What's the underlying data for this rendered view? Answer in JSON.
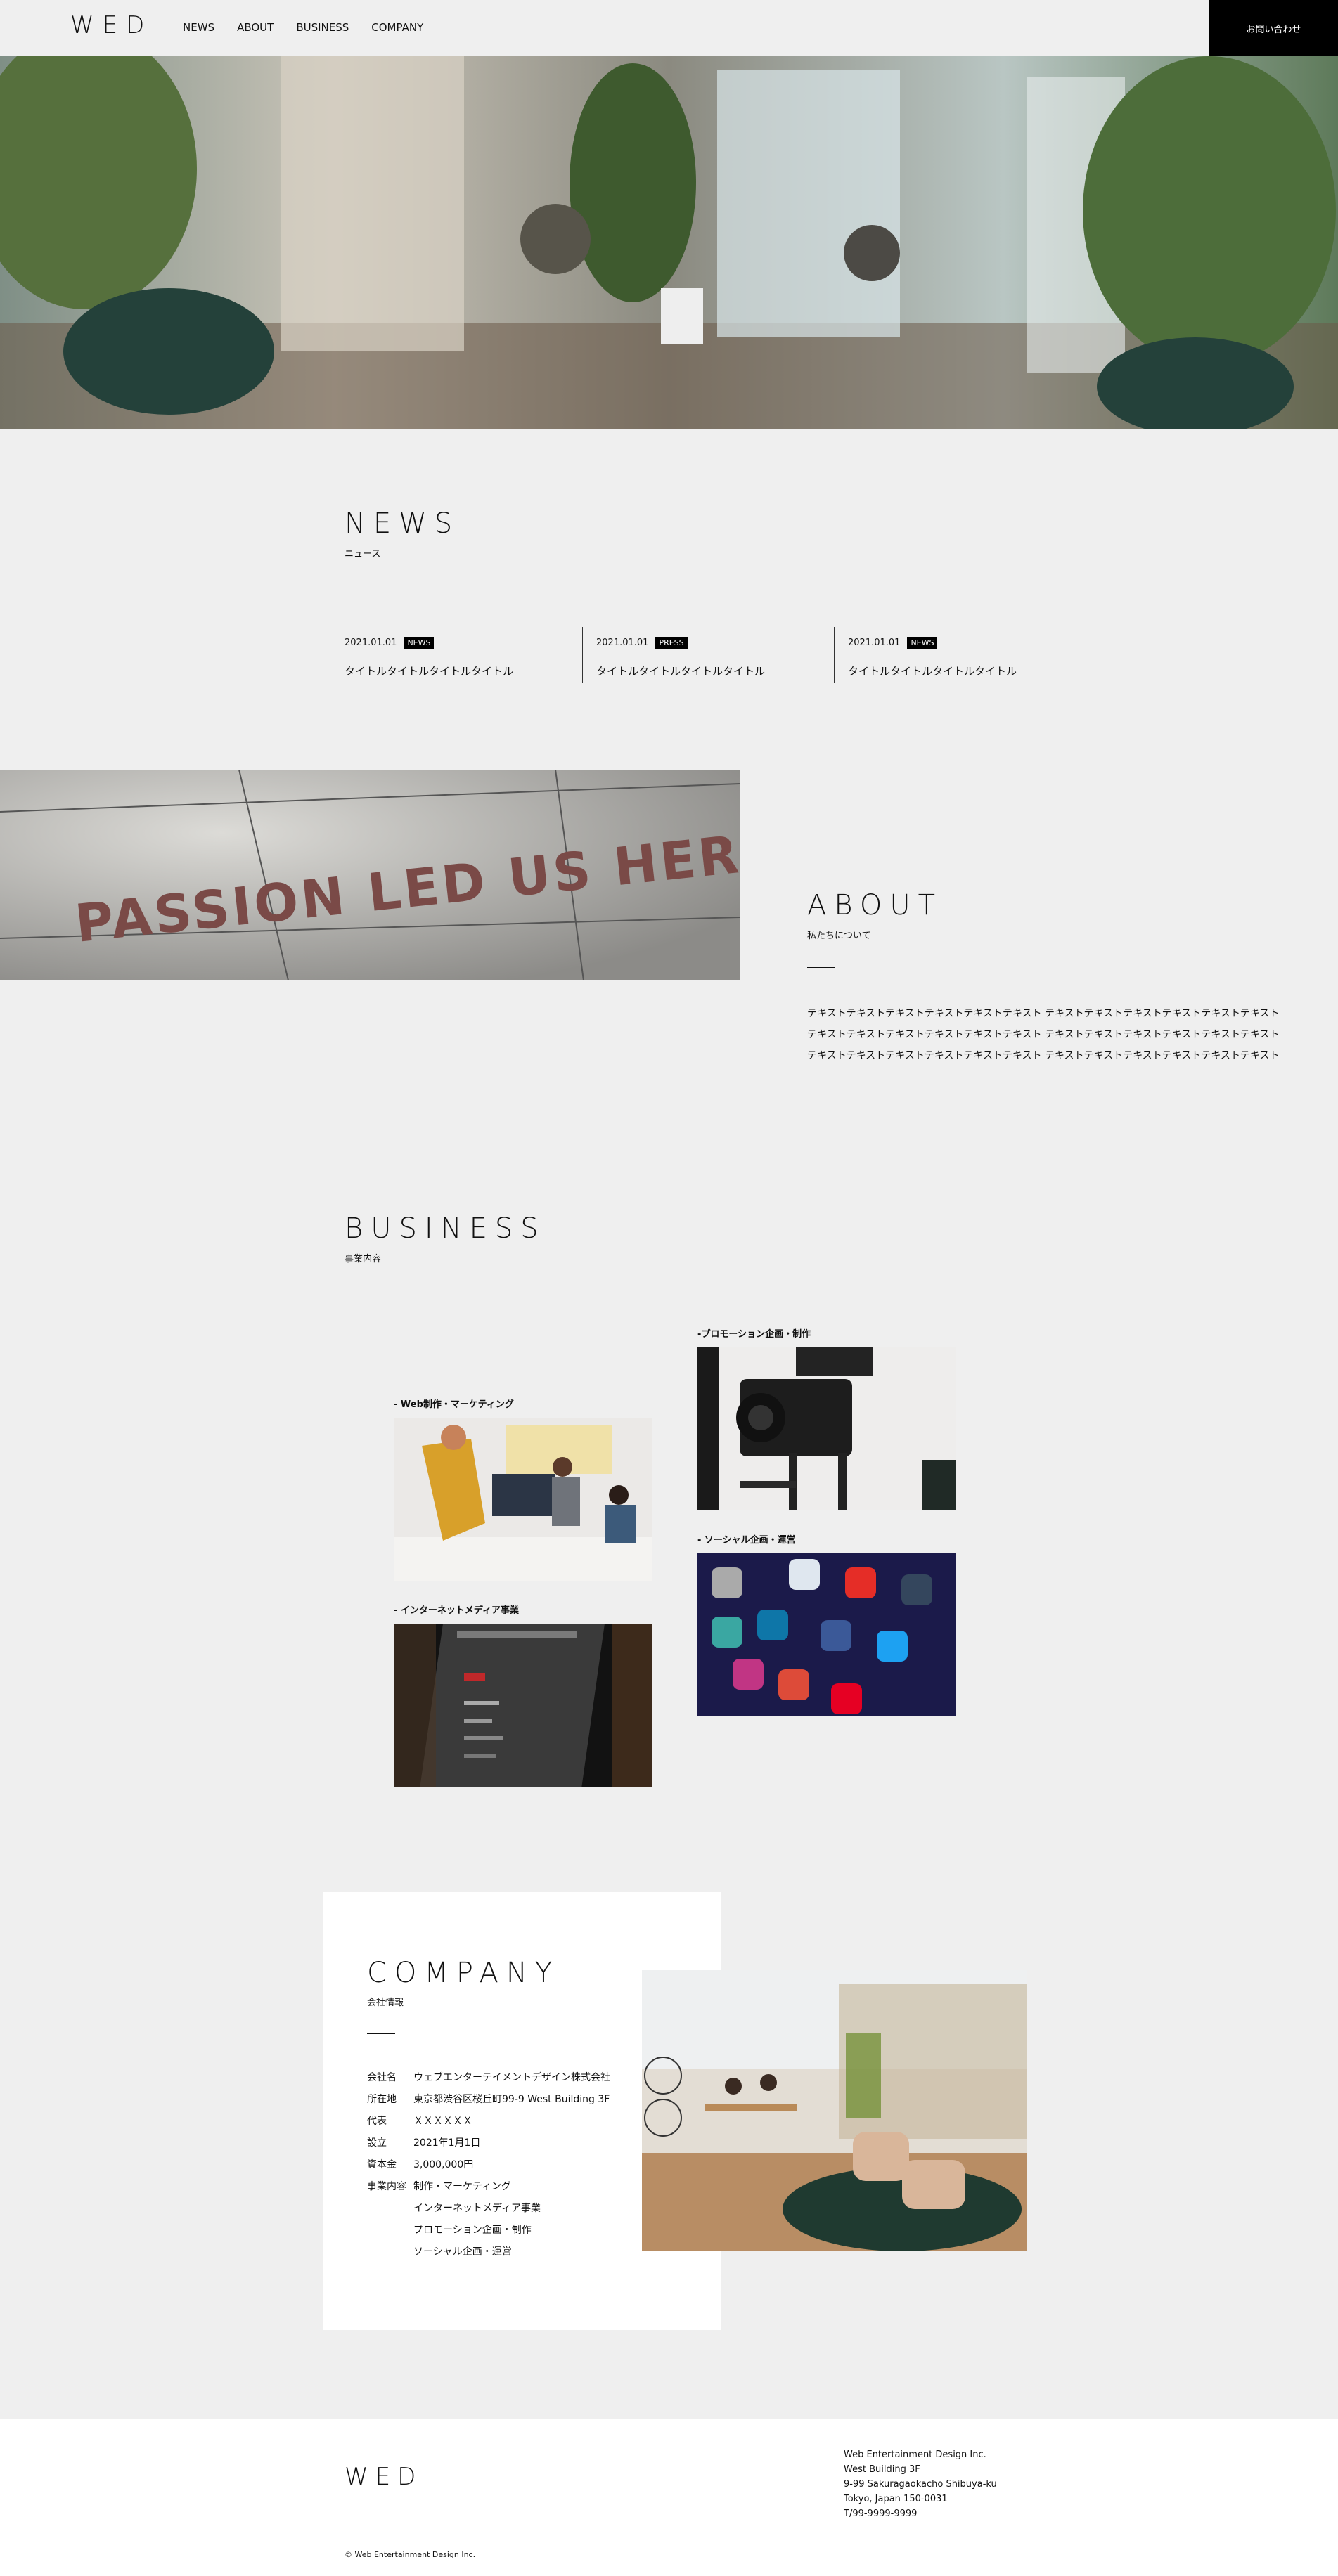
{
  "header": {
    "logo": "WED",
    "nav": [
      "NEWS",
      "ABOUT",
      "BUSINESS",
      "COMPANY"
    ],
    "contact": "お問い合わせ"
  },
  "news": {
    "title": "NEWS",
    "subtitle": "ニュース",
    "items": [
      {
        "date": "2021.01.01",
        "tag": "NEWS",
        "title": "タイトルタイトルタイトルタイトル"
      },
      {
        "date": "2021.01.01",
        "tag": "PRESS",
        "title": "タイトルタイトルタイトルタイトル"
      },
      {
        "date": "2021.01.01",
        "tag": "NEWS",
        "title": "タイトルタイトルタイトルタイトル"
      }
    ]
  },
  "about": {
    "title": "ABOUT",
    "subtitle": "私たちについて",
    "image_text": "PASSION LED US HERE",
    "paragraphs": [
      "テキストテキストテキストテキストテキストテキスト テキストテキストテキストテキストテキストテキスト",
      "テキストテキストテキストテキストテキストテキスト テキストテキストテキストテキストテキストテキスト",
      "テキストテキストテキストテキストテキストテキスト テキストテキストテキストテキストテキストテキスト"
    ]
  },
  "business": {
    "title": "BUSINESS",
    "subtitle": "事業内容",
    "items": [
      {
        "label": "- Web制作・マーケティング"
      },
      {
        "label": "- インターネットメディア事業"
      },
      {
        "label": "-プロモーション企画・制作"
      },
      {
        "label": "- ソーシャル企画・運営"
      }
    ]
  },
  "company": {
    "title": "COMPANY",
    "subtitle": "会社情報",
    "rows": [
      {
        "k": "会社名",
        "v": "ウェブエンターテイメントデザイン株式会社"
      },
      {
        "k": "所在地",
        "v": "東京都渋谷区桜丘町99-9 West Building 3F"
      },
      {
        "k": "代表",
        "v": "ＸＸＸＸＸＸ"
      },
      {
        "k": "設立",
        "v": "2021年1月1日"
      },
      {
        "k": "資本金",
        "v": "3,000,000円"
      },
      {
        "k": "事業内容",
        "v": "制作・マーケティング"
      },
      {
        "k": "",
        "v": "インターネットメディア事業"
      },
      {
        "k": "",
        "v": "プロモーション企画・制作"
      },
      {
        "k": "",
        "v": "ソーシャル企画・運営"
      }
    ]
  },
  "footer": {
    "logo": "WED",
    "address": [
      "Web Entertainment Design Inc.",
      "West Building 3F",
      "9-99 Sakuragaokacho Shibuya-ku",
      "Tokyo, Japan 150-0031",
      "T/99-9999-9999"
    ],
    "copyright": "© Web Entertainment Design Inc."
  }
}
